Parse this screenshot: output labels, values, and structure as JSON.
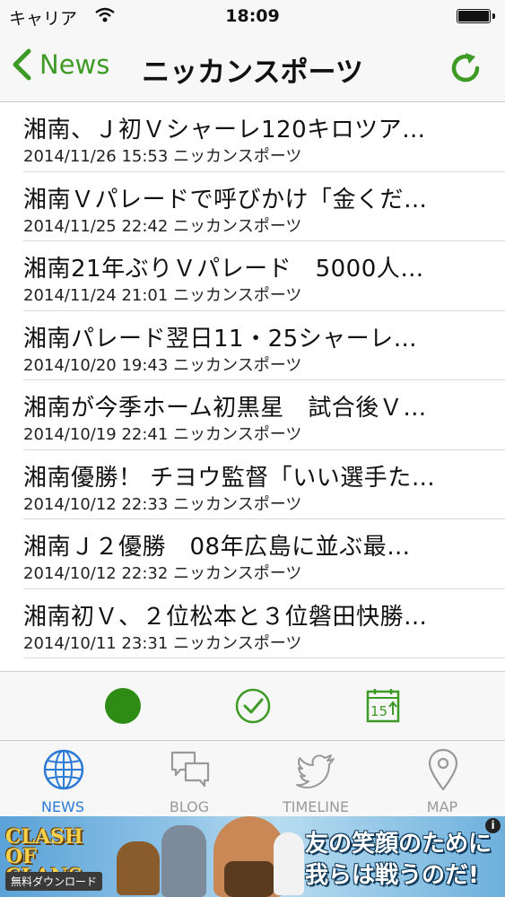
{
  "status_bar": {
    "carrier": "キャリア",
    "time": "18:09"
  },
  "nav": {
    "back_label": "News",
    "title": "ニッカンスポーツ"
  },
  "articles": [
    {
      "title": "湘南、Ｊ初Ｖシャーレ120キロツア…",
      "meta": "2014/11/26 15:53 ニッカンスポーツ"
    },
    {
      "title": "湘南Ｖパレードで呼びかけ「金くだ…",
      "meta": "2014/11/25 22:42 ニッカンスポーツ"
    },
    {
      "title": "湘南21年ぶりＶパレード　5000人…",
      "meta": "2014/11/24 21:01 ニッカンスポーツ"
    },
    {
      "title": "湘南パレード翌日11・25シャーレ…",
      "meta": "2014/10/20 19:43 ニッカンスポーツ"
    },
    {
      "title": "湘南が今季ホーム初黒星　試合後Ｖ…",
      "meta": "2014/10/19 22:41 ニッカンスポーツ"
    },
    {
      "title": "湘南優勝！ チヨウ監督「いい選手た…",
      "meta": "2014/10/12 22:33 ニッカンスポーツ"
    },
    {
      "title": "湘南Ｊ２優勝　08年広島に並ぶ最…",
      "meta": "2014/10/12 22:32 ニッカンスポーツ"
    },
    {
      "title": "湘南初Ｖ、２位松本と３位磐田快勝…",
      "meta": "2014/10/11 23:31 ニッカンスポーツ"
    }
  ],
  "toolbar": {
    "calendar_number": "15"
  },
  "tabs": [
    {
      "label": "NEWS",
      "icon": "globe-icon",
      "active": true
    },
    {
      "label": "BLOG",
      "icon": "speech-bubbles-icon",
      "active": false
    },
    {
      "label": "TIMELINE",
      "icon": "twitter-bird-icon",
      "active": false
    },
    {
      "label": "MAP",
      "icon": "map-pin-icon",
      "active": false
    }
  ],
  "ad": {
    "logo": "CLASH OF CLANS",
    "download": "無料ダウンロード",
    "copy_line1": "友の笑顔のために",
    "copy_line2": "我らは戦うのだ!",
    "info": "i"
  },
  "colors": {
    "accent_green": "#3d9a24",
    "active_tab_blue": "#2a7ad6",
    "inactive_gray": "#999999"
  }
}
